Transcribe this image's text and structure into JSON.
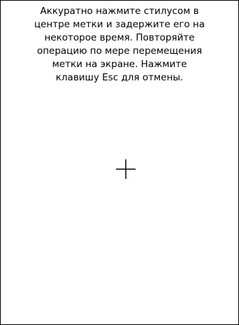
{
  "calibration": {
    "instructions": "Аккуратно нажмите стилусом в\nцентре метки и задержите его на\nнекоторое время. Повторяйте\nоперацию по мере перемещения\nметки на экране. Нажмите\nклавишу Esc для отмены.",
    "target_icon": "crosshair-icon",
    "colors": {
      "background": "#ffffff",
      "text": "#000000",
      "border": "#000000",
      "target": "#000000"
    }
  }
}
